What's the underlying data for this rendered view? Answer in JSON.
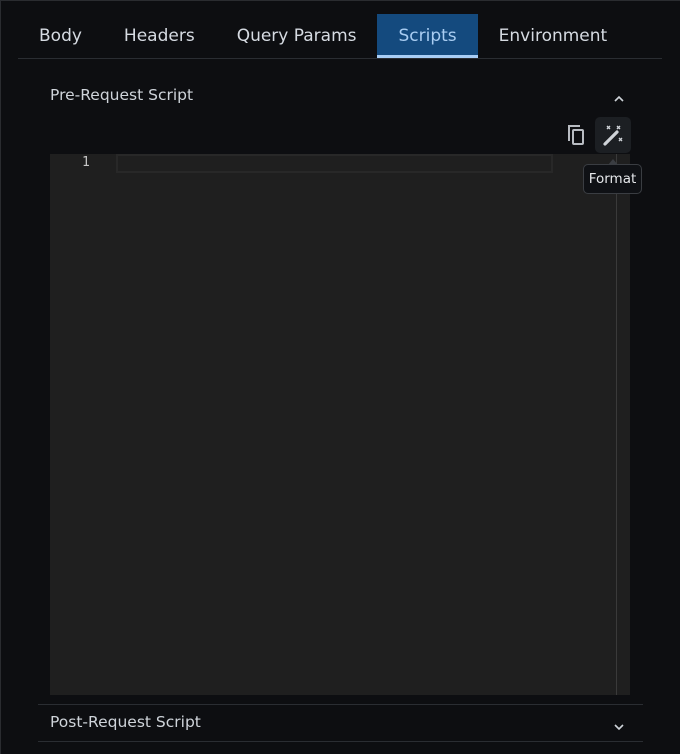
{
  "tabs": [
    {
      "label": "Body"
    },
    {
      "label": "Headers"
    },
    {
      "label": "Query Params"
    },
    {
      "label": "Scripts",
      "active": true
    },
    {
      "label": "Environment"
    }
  ],
  "pre_request": {
    "title": "Pre-Request Script",
    "expanded": true,
    "line_numbers": [
      "1"
    ],
    "code": ""
  },
  "toolbar": {
    "copy_icon": "copy-icon",
    "format_icon": "magic-wand-icon",
    "format_tooltip": "Format"
  },
  "post_request": {
    "title": "Post-Request Script",
    "expanded": false
  },
  "colors": {
    "accent": "#144a7e",
    "accent_underline": "#a8cdf5",
    "editor_bg": "#1f1f1f"
  }
}
